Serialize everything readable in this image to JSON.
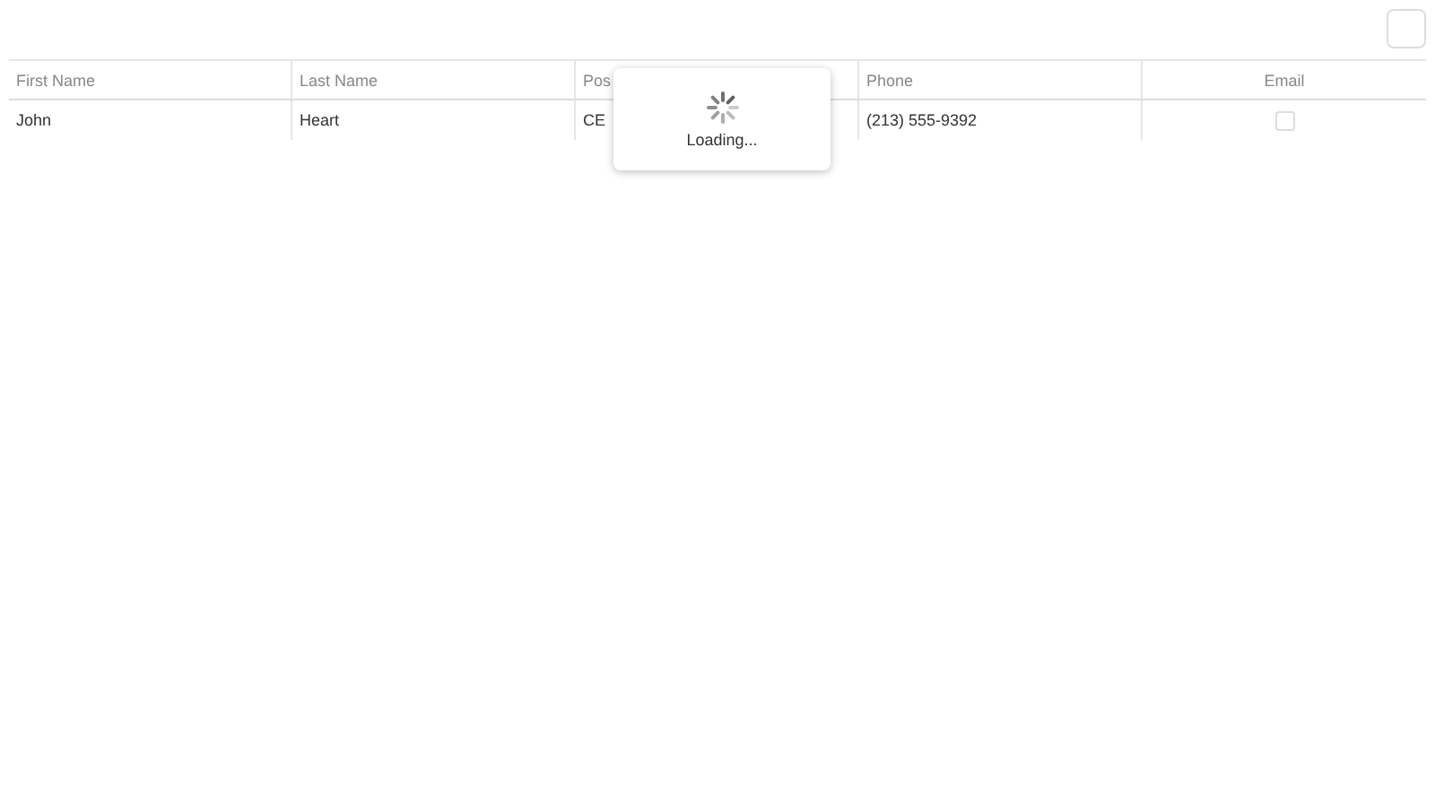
{
  "table": {
    "columns": [
      {
        "label": "First Name"
      },
      {
        "label": "Last Name"
      },
      {
        "label": "Pos"
      },
      {
        "label": "Phone"
      },
      {
        "label": "Email"
      }
    ],
    "rows": [
      {
        "cells": [
          {
            "kind": "text",
            "text": "John"
          },
          {
            "kind": "text",
            "text": "Heart"
          },
          {
            "kind": "text",
            "text": "CE"
          },
          {
            "kind": "text",
            "text": "(213) 555-9392"
          },
          {
            "kind": "checkbox",
            "checked": false
          }
        ]
      }
    ]
  },
  "loading": {
    "text": "Loading..."
  }
}
